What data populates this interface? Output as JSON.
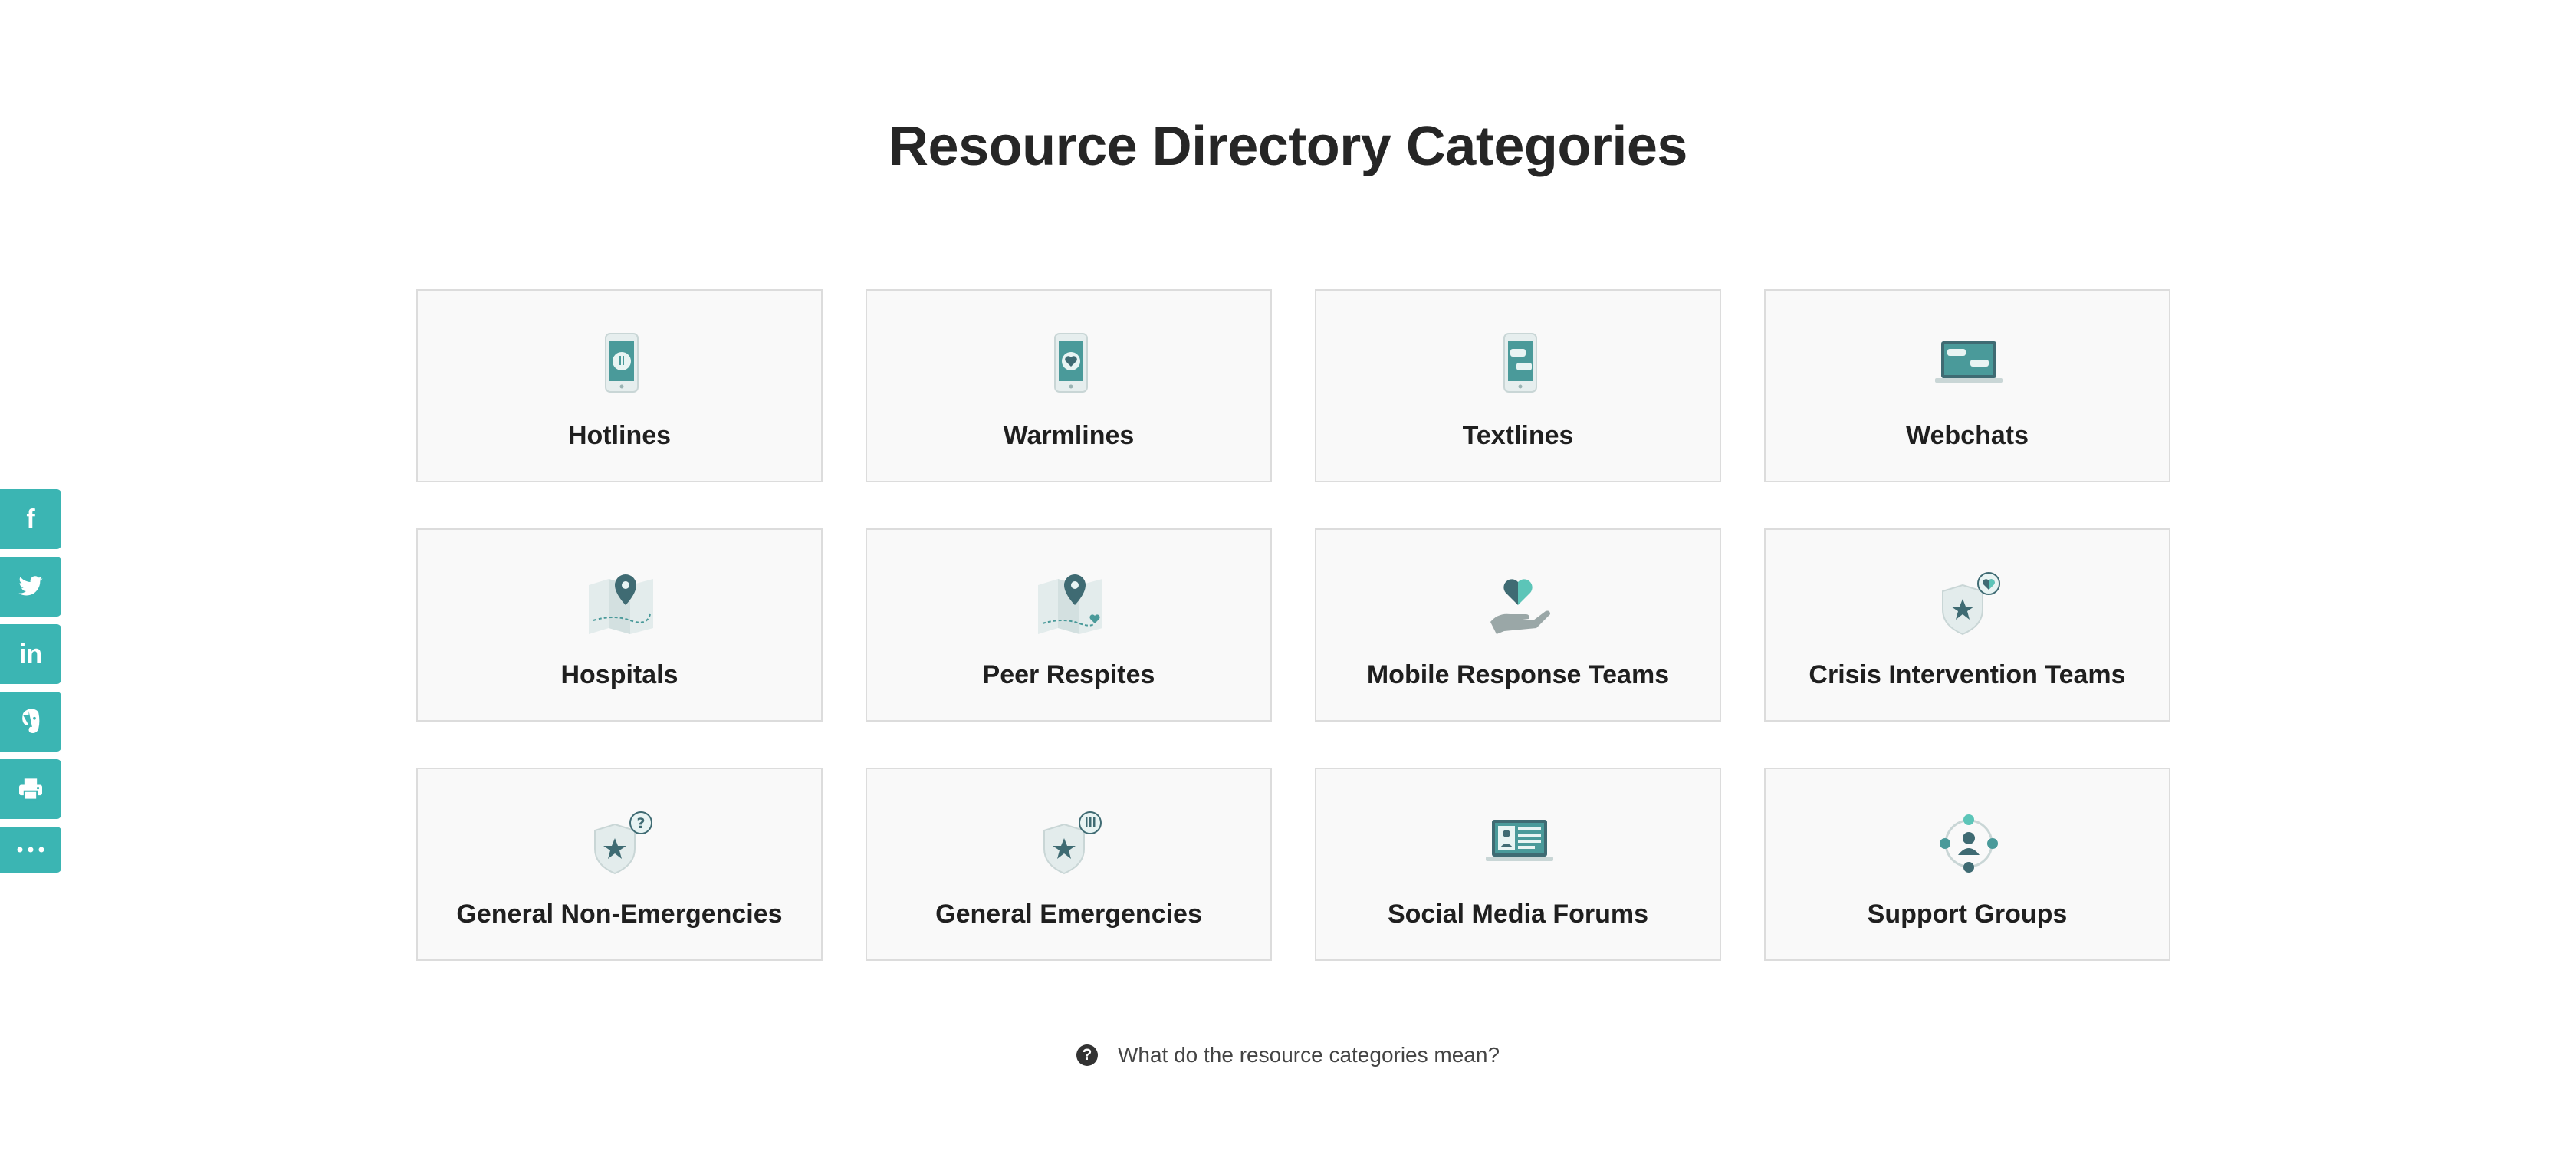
{
  "page": {
    "title": "Resource Directory Categories"
  },
  "categories": [
    {
      "label": "Hotlines",
      "icon": "phone-alert-icon"
    },
    {
      "label": "Warmlines",
      "icon": "phone-heart-icon"
    },
    {
      "label": "Textlines",
      "icon": "phone-chat-icon"
    },
    {
      "label": "Webchats",
      "icon": "laptop-chat-icon"
    },
    {
      "label": "Hospitals",
      "icon": "map-pin-icon"
    },
    {
      "label": "Peer Respites",
      "icon": "map-pin-heart-icon"
    },
    {
      "label": "Mobile Response Teams",
      "icon": "hand-heart-icon"
    },
    {
      "label": "Crisis Intervention Teams",
      "icon": "shield-heart-icon"
    },
    {
      "label": "General Non-Emergencies",
      "icon": "shield-question-icon"
    },
    {
      "label": "General Emergencies",
      "icon": "shield-alert-icon"
    },
    {
      "label": "Social Media Forums",
      "icon": "laptop-profile-icon"
    },
    {
      "label": "Support Groups",
      "icon": "people-network-icon"
    }
  ],
  "share": {
    "facebook": "f",
    "twitter_icon": "twitter-icon",
    "linkedin": "in",
    "evernote_icon": "evernote-icon",
    "print_icon": "print-icon",
    "more_icon": "more-icon"
  },
  "help": {
    "text": "What do the resource categories mean?",
    "icon_glyph": "?"
  },
  "colors": {
    "accent": "#3bb5b3",
    "icon_teal": "#4a9a9a",
    "icon_dark": "#3f6b73",
    "card_bg": "#f9f9f9",
    "card_border": "#dcdcdc"
  }
}
